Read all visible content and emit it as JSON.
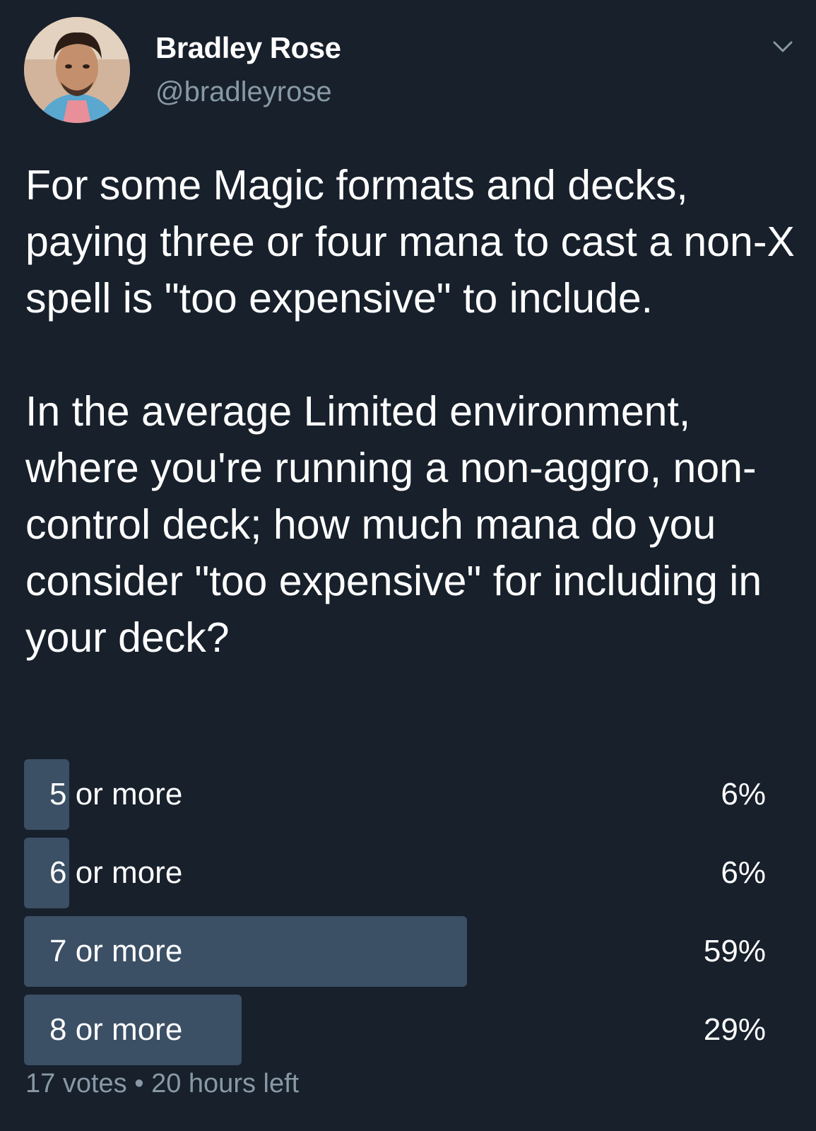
{
  "author": {
    "name": "Bradley Rose",
    "handle": "@bradleyrose",
    "avatar_icon": "profile-photo"
  },
  "menu_icon": "chevron-down-icon",
  "tweet": {
    "paragraphs": [
      "For some Magic formats and decks, paying three or four mana to cast a non-X spell is \"too expensive\" to include.",
      "In the average Limited environment, where you're running a non-aggro, non-control deck; how much mana do you consider \"too expensive\" for including in your deck?"
    ]
  },
  "poll": {
    "options": [
      {
        "label": "5 or more",
        "percent_text": "6%",
        "percent": 6
      },
      {
        "label": "6 or more",
        "percent_text": "6%",
        "percent": 6
      },
      {
        "label": "7 or more",
        "percent_text": "59%",
        "percent": 59
      },
      {
        "label": "8 or more",
        "percent_text": "29%",
        "percent": 29
      }
    ],
    "votes": "17 votes",
    "separator": "•",
    "time_left": "20 hours left",
    "bar_color": "#3b4f65"
  },
  "colors": {
    "background": "#17202b",
    "text_primary": "#ffffff",
    "text_secondary": "#8899a6"
  }
}
